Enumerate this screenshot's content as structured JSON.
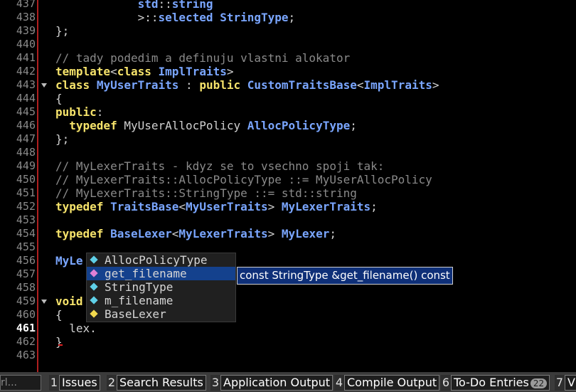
{
  "editor": {
    "current_line": "461",
    "lines": [
      {
        "num": "437",
        "tokens": [
          {
            "t": "            ",
            "c": "pl"
          },
          {
            "t": "std",
            "c": "ty"
          },
          {
            "t": "::",
            "c": "pl"
          },
          {
            "t": "string",
            "c": "ty"
          }
        ]
      },
      {
        "num": "438",
        "tokens": [
          {
            "t": "            ",
            "c": "pl"
          },
          {
            "t": ">::",
            "c": "pl"
          },
          {
            "t": "selected",
            "c": "ty"
          },
          {
            "t": " ",
            "c": "pl"
          },
          {
            "t": "StringType",
            "c": "ty"
          },
          {
            "t": ";",
            "c": "pl"
          }
        ]
      },
      {
        "num": "439",
        "tokens": [
          {
            "t": "};",
            "c": "pl"
          }
        ]
      },
      {
        "num": "440",
        "tokens": []
      },
      {
        "num": "441",
        "tokens": [
          {
            "t": "// tady podedim a definuju vlastni alokator",
            "c": "cm"
          }
        ]
      },
      {
        "num": "442",
        "tokens": [
          {
            "t": "template",
            "c": "kw"
          },
          {
            "t": "<",
            "c": "pl"
          },
          {
            "t": "class",
            "c": "kw"
          },
          {
            "t": " ",
            "c": "pl"
          },
          {
            "t": "ImplTraits",
            "c": "ty"
          },
          {
            "t": ">",
            "c": "pl"
          }
        ]
      },
      {
        "num": "443",
        "fold": true,
        "tokens": [
          {
            "t": "class",
            "c": "kw"
          },
          {
            "t": " ",
            "c": "pl"
          },
          {
            "t": "MyUserTraits",
            "c": "ty"
          },
          {
            "t": " : ",
            "c": "pl"
          },
          {
            "t": "public",
            "c": "kw"
          },
          {
            "t": " ",
            "c": "pl"
          },
          {
            "t": "CustomTraitsBase",
            "c": "ty"
          },
          {
            "t": "<",
            "c": "pl"
          },
          {
            "t": "ImplTraits",
            "c": "ty"
          },
          {
            "t": ">",
            "c": "pl"
          }
        ]
      },
      {
        "num": "444",
        "tokens": [
          {
            "t": "{",
            "c": "pl"
          }
        ]
      },
      {
        "num": "445",
        "tokens": [
          {
            "t": "public",
            "c": "kw"
          },
          {
            "t": ":",
            "c": "pl"
          }
        ]
      },
      {
        "num": "446",
        "tokens": [
          {
            "t": "  ",
            "c": "pl"
          },
          {
            "t": "typedef",
            "c": "kw"
          },
          {
            "t": " MyUserAllocPolicy ",
            "c": "pl"
          },
          {
            "t": "AllocPolicyType",
            "c": "ty"
          },
          {
            "t": ";",
            "c": "pl"
          }
        ]
      },
      {
        "num": "447",
        "tokens": [
          {
            "t": "};",
            "c": "pl"
          }
        ]
      },
      {
        "num": "448",
        "tokens": []
      },
      {
        "num": "449",
        "tokens": [
          {
            "t": "// MyLexerTraits - kdyz se to vsechno spoji tak:",
            "c": "cm"
          }
        ]
      },
      {
        "num": "450",
        "tokens": [
          {
            "t": "// MyLexerTraits::AllocPolicyType ::= MyUserAllocPolicy",
            "c": "cm"
          }
        ]
      },
      {
        "num": "451",
        "tokens": [
          {
            "t": "// MyLexerTraits::StringType ::= std::string",
            "c": "cm"
          }
        ]
      },
      {
        "num": "452",
        "tokens": [
          {
            "t": "typedef",
            "c": "kw"
          },
          {
            "t": " ",
            "c": "pl"
          },
          {
            "t": "TraitsBase",
            "c": "ty"
          },
          {
            "t": "<",
            "c": "pl"
          },
          {
            "t": "MyUserTraits",
            "c": "ty"
          },
          {
            "t": "> ",
            "c": "pl"
          },
          {
            "t": "MyLexerTraits",
            "c": "ty"
          },
          {
            "t": ";",
            "c": "pl"
          }
        ]
      },
      {
        "num": "453",
        "tokens": []
      },
      {
        "num": "454",
        "tokens": [
          {
            "t": "typedef",
            "c": "kw"
          },
          {
            "t": " ",
            "c": "pl"
          },
          {
            "t": "BaseLexer",
            "c": "ty"
          },
          {
            "t": "<",
            "c": "pl"
          },
          {
            "t": "MyLexerTraits",
            "c": "ty"
          },
          {
            "t": "> ",
            "c": "pl"
          },
          {
            "t": "MyLexer",
            "c": "ty"
          },
          {
            "t": ";",
            "c": "pl"
          }
        ]
      },
      {
        "num": "455",
        "tokens": []
      },
      {
        "num": "456",
        "tokens": [
          {
            "t": "MyLe",
            "c": "ty"
          }
        ]
      },
      {
        "num": "457",
        "tokens": []
      },
      {
        "num": "458",
        "tokens": []
      },
      {
        "num": "459",
        "fold": true,
        "tokens": [
          {
            "t": "void",
            "c": "kw"
          }
        ]
      },
      {
        "num": "460",
        "tokens": [
          {
            "t": "{",
            "c": "pl"
          }
        ]
      },
      {
        "num": "461",
        "tokens": [
          {
            "t": "  lex.",
            "c": "pl"
          }
        ]
      },
      {
        "num": "462",
        "tokens": [
          {
            "t": "}",
            "c": "pl"
          }
        ]
      },
      {
        "num": "463",
        "tokens": []
      }
    ]
  },
  "completion": {
    "items": [
      {
        "label": "AllocPolicyType",
        "icon": "type-icon",
        "color": "#5fd0e8",
        "selected": false
      },
      {
        "label": "get_filename",
        "icon": "method-icon",
        "color": "#e080d6",
        "selected": true
      },
      {
        "label": "StringType",
        "icon": "type-icon",
        "color": "#5fd0e8",
        "selected": false
      },
      {
        "label": "m_filename",
        "icon": "member-icon",
        "color": "#5fd0e8",
        "selected": false
      },
      {
        "label": "BaseLexer",
        "icon": "class-icon",
        "color": "#f2d94e",
        "selected": false
      }
    ],
    "tooltip": "const StringType &get_filename() const"
  },
  "statusbar": {
    "locator_text": "rl...",
    "panes": [
      {
        "num": "1",
        "label": "Issues"
      },
      {
        "num": "2",
        "label": "Search Results"
      },
      {
        "num": "3",
        "label": "Application Output"
      },
      {
        "num": "4",
        "label": "Compile Output"
      },
      {
        "num": "6",
        "label": "To-Do Entries",
        "badge": "22"
      },
      {
        "num": "7",
        "label": "V"
      }
    ]
  },
  "colors": {
    "keyword": "#f6e36b",
    "type": "#7aa6ff",
    "comment": "#8a8a8a",
    "selection": "#14418d",
    "gutter_marker": "#b01f1f"
  }
}
